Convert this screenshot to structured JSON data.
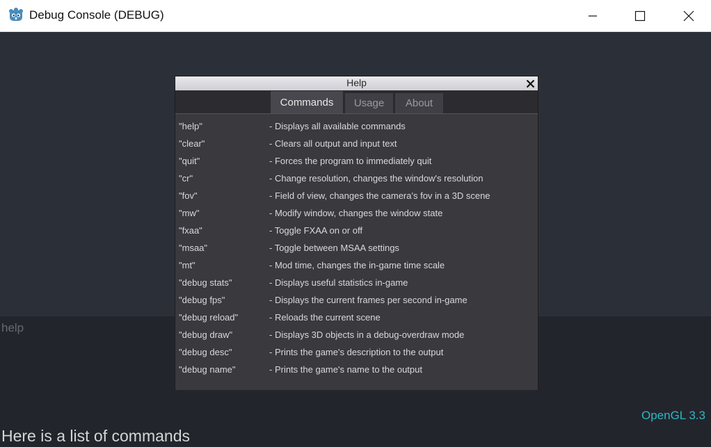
{
  "window": {
    "title": "Debug Console (DEBUG)",
    "icon": "godot-icon",
    "controls": [
      "minimize-icon",
      "maximize-icon",
      "close-icon"
    ]
  },
  "console": {
    "input_value": "help",
    "output_text": "Here is a list of commands",
    "renderer": "OpenGL 3.3"
  },
  "dialog": {
    "title": "Help",
    "tabs": [
      {
        "label": "Commands",
        "active": true
      },
      {
        "label": "Usage",
        "active": false
      },
      {
        "label": "About",
        "active": false
      }
    ],
    "commands": [
      {
        "name": "\"help\"",
        "desc": "- Displays all available commands"
      },
      {
        "name": "\"clear\"",
        "desc": "- Clears all output and input text"
      },
      {
        "name": "\"quit\"",
        "desc": "- Forces the program to immediately quit"
      },
      {
        "name": "\"cr\"",
        "desc": "- Change resolution, changes the window's resolution"
      },
      {
        "name": "\"fov\"",
        "desc": "- Field of view, changes the camera's fov in a 3D scene"
      },
      {
        "name": "\"mw\"",
        "desc": "- Modify window, changes the window state"
      },
      {
        "name": "\"fxaa\"",
        "desc": "- Toggle FXAA on or off"
      },
      {
        "name": "\"msaa\"",
        "desc": "- Toggle between MSAA settings"
      },
      {
        "name": "\"mt\"",
        "desc": "- Mod time, changes the in-game time scale"
      },
      {
        "name": "\"debug stats\"",
        "desc": "- Displays useful statistics in-game"
      },
      {
        "name": "\"debug fps\"",
        "desc": "- Displays the current frames per second in-game"
      },
      {
        "name": "\"debug reload\"",
        "desc": "- Reloads the current scene"
      },
      {
        "name": "\"debug draw\"",
        "desc": "- Displays 3D objects in a debug-overdraw mode"
      },
      {
        "name": "\"debug desc\"",
        "desc": "- Prints the game's description to the output"
      },
      {
        "name": "\"debug name\"",
        "desc": "- Prints the game's name to the output"
      }
    ]
  },
  "colors": {
    "accent": "#2fb6c4",
    "background": "#22262c",
    "viewport": "#2b3038",
    "dialog": "#3a393e"
  }
}
